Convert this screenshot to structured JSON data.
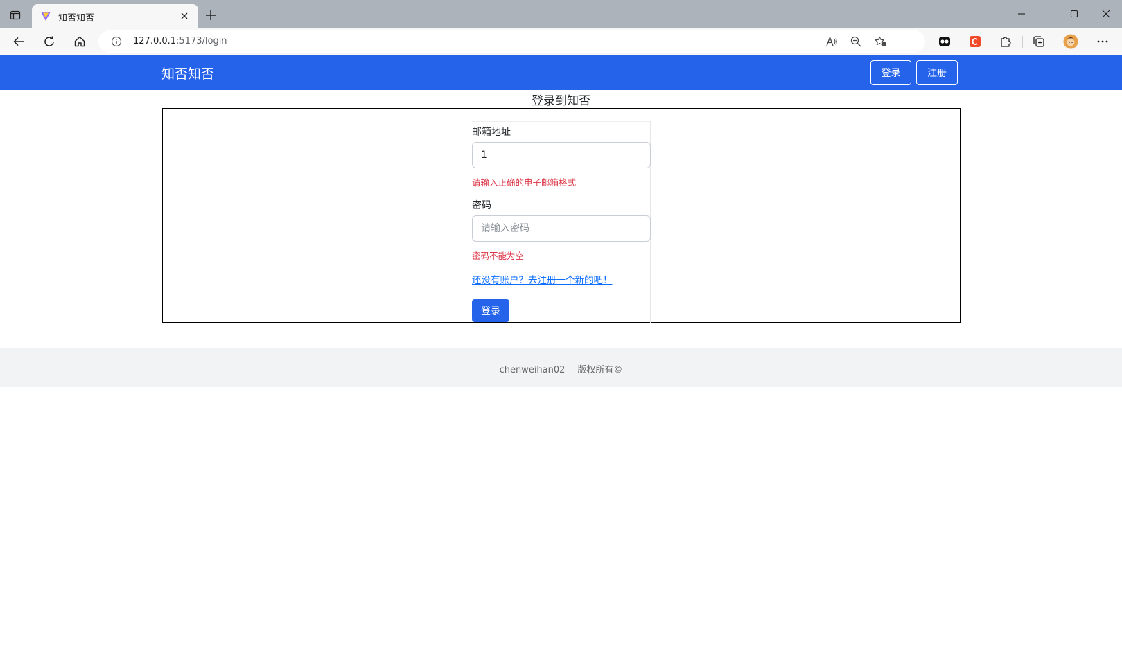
{
  "browser": {
    "tab": {
      "title": "知否知否"
    },
    "address": {
      "host": "127.0.0.1",
      "rest": ":5173/login"
    }
  },
  "navbar": {
    "brand": "知否知否",
    "login_label": "登录",
    "register_label": "注册",
    "bg_color": "#2563eb"
  },
  "login": {
    "heading": "登录到知否",
    "email_label": "邮箱地址",
    "email_value": "1",
    "email_error": "请输入正确的电子邮箱格式",
    "password_label": "密码",
    "password_placeholder": "请输入密码",
    "password_error": "密码不能为空",
    "register_link": "还没有账户？去注册一个新的吧！",
    "submit_label": "登录"
  },
  "footer": {
    "author": "chenweihan02",
    "copyright": "版权所有©"
  }
}
